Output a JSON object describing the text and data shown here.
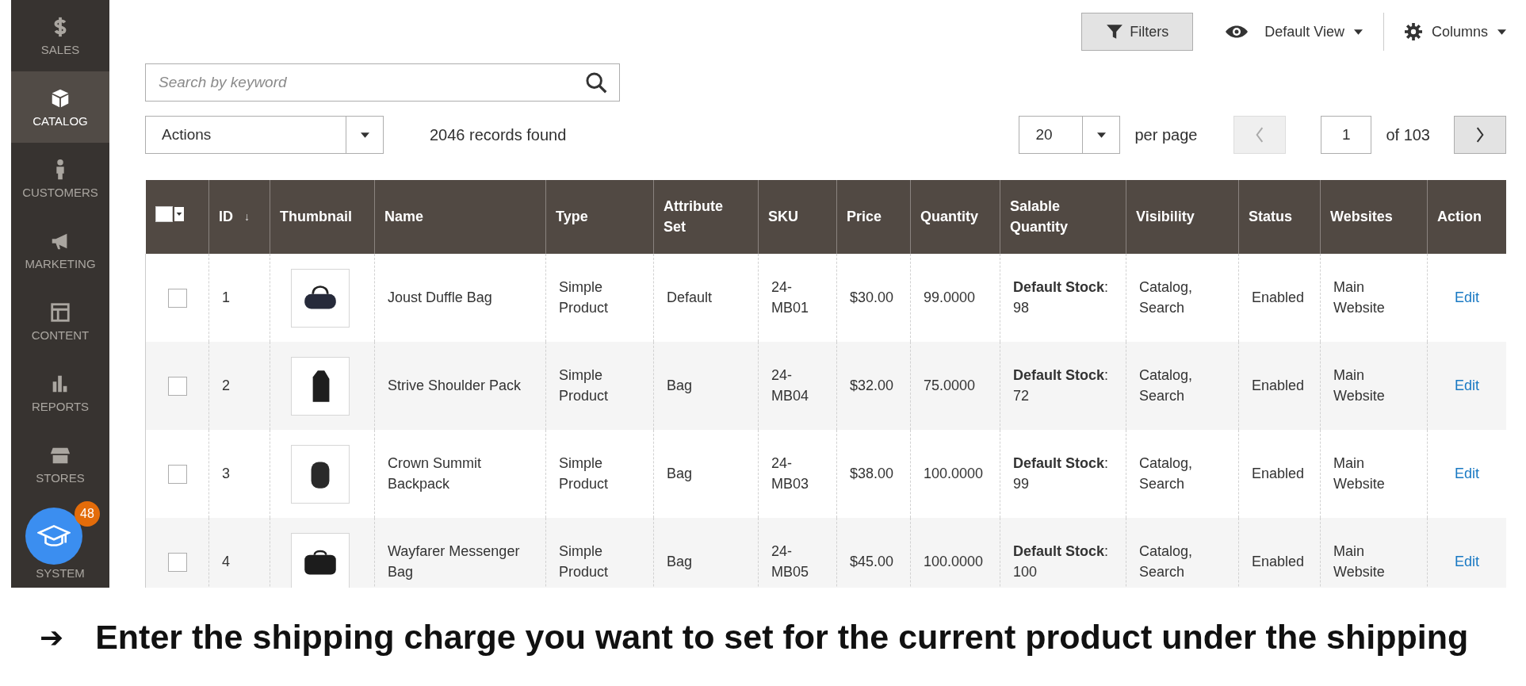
{
  "sidebar": {
    "items": [
      {
        "label": "SALES",
        "selected": false
      },
      {
        "label": "CATALOG",
        "selected": true
      },
      {
        "label": "CUSTOMERS",
        "selected": false
      },
      {
        "label": "MARKETING",
        "selected": false
      },
      {
        "label": "CONTENT",
        "selected": false
      },
      {
        "label": "REPORTS",
        "selected": false
      },
      {
        "label": "STORES",
        "selected": false
      },
      {
        "label": "SYSTEM",
        "selected": false
      }
    ]
  },
  "help_badge": {
    "count": "48"
  },
  "toolbar": {
    "filters": "Filters",
    "view": "Default View",
    "columns": "Columns"
  },
  "search": {
    "placeholder": "Search by keyword"
  },
  "actions": {
    "value": "Actions"
  },
  "records": "2046 records found",
  "pager": {
    "per_page_value": "20",
    "per_page_label": "per page",
    "prev_disabled": true,
    "page": "1",
    "of_total": "of 103"
  },
  "table": {
    "select_all": {
      "checked": false
    },
    "columns": [
      {
        "label": "ID",
        "sort_mark": "↓"
      },
      {
        "label": "Thumbnail"
      },
      {
        "label": "Name"
      },
      {
        "label": "Type"
      },
      {
        "label": "Attribute Set"
      },
      {
        "label": "SKU"
      },
      {
        "label": "Price"
      },
      {
        "label": "Quantity"
      },
      {
        "label": "Salable Quantity"
      },
      {
        "label": "Visibility"
      },
      {
        "label": "Status"
      },
      {
        "label": "Websites"
      },
      {
        "label": "Action"
      }
    ],
    "rows": [
      {
        "checked": false,
        "id": "1",
        "name": "Joust Duffle Bag",
        "type": "Simple Product",
        "attribute_set": "Default",
        "sku": "24-MB01",
        "price": "$30.00",
        "quantity": "99.0000",
        "salable_quantity": "**Default Stock**: 98",
        "visibility": "Catalog, Search",
        "status": "Enabled",
        "websites": "Main Website",
        "action": "Edit"
      },
      {
        "checked": false,
        "id": "2",
        "name": "Strive Shoulder Pack",
        "type": "Simple Product",
        "attribute_set": "Bag",
        "sku": "24-MB04",
        "price": "$32.00",
        "quantity": "75.0000",
        "salable_quantity": "**Default Stock**: 72",
        "visibility": "Catalog, Search",
        "status": "Enabled",
        "websites": "Main Website",
        "action": "Edit"
      },
      {
        "checked": false,
        "id": "3",
        "name": "Crown Summit Backpack",
        "type": "Simple Product",
        "attribute_set": "Bag",
        "sku": "24-MB03",
        "price": "$38.00",
        "quantity": "100.0000",
        "salable_quantity": "**Default Stock**: 99",
        "visibility": "Catalog, Search",
        "status": "Enabled",
        "websites": "Main Website",
        "action": "Edit"
      },
      {
        "checked": false,
        "id": "4",
        "name": "Wayfarer Messenger Bag",
        "type": "Simple Product",
        "attribute_set": "Bag",
        "sku": "24-MB05",
        "price": "$45.00",
        "quantity": "100.0000",
        "salable_quantity": "**Default Stock**: 100",
        "visibility": "Catalog, Search",
        "status": "Enabled",
        "websites": "Main Website",
        "action": "Edit"
      }
    ]
  },
  "caption": {
    "arrow": "➔",
    "text": "Enter the shipping charge you want to set for the current product under the shipping"
  }
}
